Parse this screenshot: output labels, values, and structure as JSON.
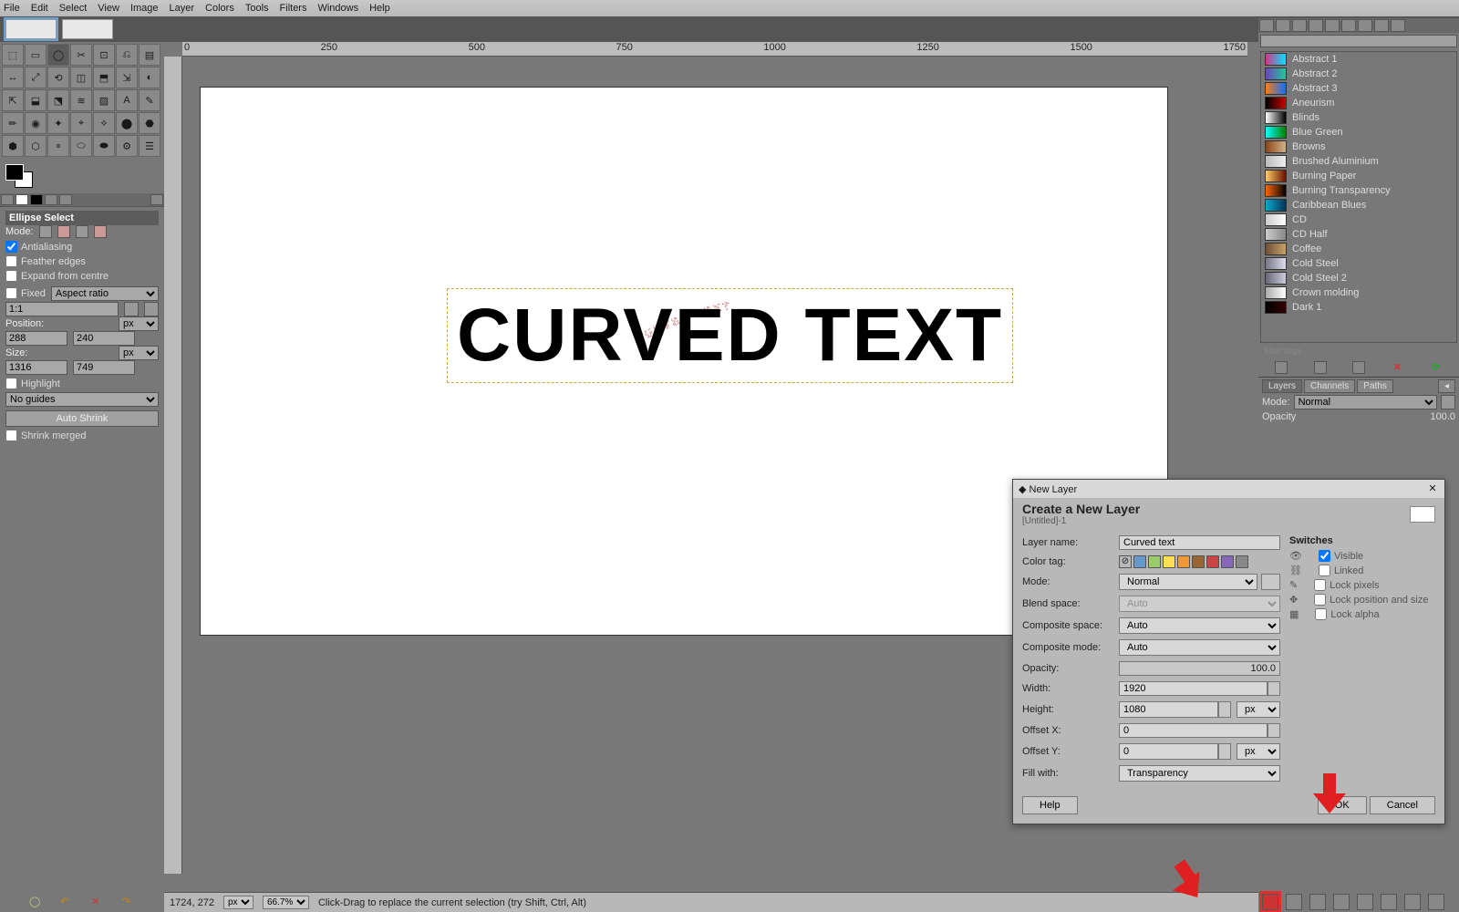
{
  "menubar": [
    "File",
    "Edit",
    "Select",
    "View",
    "Image",
    "Layer",
    "Colors",
    "Tools",
    "Filters",
    "Windows",
    "Help"
  ],
  "tool_opts": {
    "title": "Ellipse Select",
    "mode_label": "Mode:",
    "antialias": "Antialiasing",
    "feather": "Feather edges",
    "expand": "Expand from centre",
    "fixed": "Fixed",
    "aspect": "Aspect ratio",
    "ratio": "1:1",
    "position": "Position:",
    "pos_x": "288",
    "pos_y": "240",
    "size": "Size:",
    "size_w": "1316",
    "size_h": "749",
    "highlight": "Highlight",
    "guides": "No guides",
    "autoshrink": "Auto Shrink",
    "shrinkmerged": "Shrink merged",
    "unit": "px"
  },
  "rulers": [
    "0",
    "250",
    "500",
    "750",
    "1000",
    "1250",
    "1500",
    "1750"
  ],
  "canvas_text": "CURVED TEXT",
  "gradients": [
    {
      "name": "Abstract 1",
      "c1": "#d63384",
      "c2": "#00e5ff"
    },
    {
      "name": "Abstract 2",
      "c1": "#6f42c1",
      "c2": "#20c997"
    },
    {
      "name": "Abstract 3",
      "c1": "#fd7e14",
      "c2": "#0d6efd"
    },
    {
      "name": "Aneurism",
      "c1": "#000",
      "c2": "#c00"
    },
    {
      "name": "Blinds",
      "c1": "#fff",
      "c2": "#000"
    },
    {
      "name": "Blue Green",
      "c1": "#00ffff",
      "c2": "#008000"
    },
    {
      "name": "Browns",
      "c1": "#8b4513",
      "c2": "#d2b48c"
    },
    {
      "name": "Brushed Aluminium",
      "c1": "#bbb",
      "c2": "#eee"
    },
    {
      "name": "Burning Paper",
      "c1": "#ffcc66",
      "c2": "#661100"
    },
    {
      "name": "Burning Transparency",
      "c1": "#ff6600",
      "c2": "#000"
    },
    {
      "name": "Caribbean Blues",
      "c1": "#00aacc",
      "c2": "#003355"
    },
    {
      "name": "CD",
      "c1": "#ccc",
      "c2": "#fff"
    },
    {
      "name": "CD Half",
      "c1": "#ccc",
      "c2": "#888"
    },
    {
      "name": "Coffee",
      "c1": "#6f4e37",
      "c2": "#c8a165"
    },
    {
      "name": "Cold Steel",
      "c1": "#778",
      "c2": "#dde"
    },
    {
      "name": "Cold Steel 2",
      "c1": "#667",
      "c2": "#ccd"
    },
    {
      "name": "Crown molding",
      "c1": "#aaa",
      "c2": "#fff"
    },
    {
      "name": "Dark 1",
      "c1": "#000",
      "c2": "#330000"
    }
  ],
  "layer_tabs": {
    "a": "Layers",
    "b": "Channels",
    "c": "Paths"
  },
  "layer_mode_label": "Mode:",
  "layer_mode": "Normal",
  "layer_opacity_label": "Opacity",
  "layer_opacity": "100.0",
  "dialog": {
    "title": "New Layer",
    "heading": "Create a New Layer",
    "sub": "[Untitled]-1",
    "layer_name_label": "Layer name:",
    "layer_name": "Curved text",
    "color_tag_label": "Color tag:",
    "mode_label": "Mode:",
    "mode": "Normal",
    "blend_label": "Blend space:",
    "blend": "Auto",
    "comp_space_label": "Composite space:",
    "comp_space": "Auto",
    "comp_mode_label": "Composite mode:",
    "comp_mode": "Auto",
    "opacity_label": "Opacity:",
    "opacity": "100.0",
    "width_label": "Width:",
    "width": "1920",
    "height_label": "Height:",
    "height": "1080",
    "unit": "px",
    "offx_label": "Offset X:",
    "offx": "0",
    "offy_label": "Offset Y:",
    "offy": "0",
    "fill_label": "Fill with:",
    "fill": "Transparency",
    "switches_h": "Switches",
    "sw_visible": "Visible",
    "sw_linked": "Linked",
    "sw_lockpx": "Lock pixels",
    "sw_lockpos": "Lock position and size",
    "sw_lockalpha": "Lock alpha",
    "help": "Help",
    "ok": "OK",
    "cancel": "Cancel"
  },
  "status": {
    "coords": "1724, 272",
    "unit": "px",
    "zoom": "66.7%",
    "hint": "Click-Drag to replace the current selection (try Shift, Ctrl, Alt)"
  },
  "colortags": [
    "#ffffff",
    "#6699cc",
    "#99cc66",
    "#ffdd55",
    "#ee9933",
    "#996633",
    "#cc4444",
    "#8866bb",
    "#888888"
  ]
}
